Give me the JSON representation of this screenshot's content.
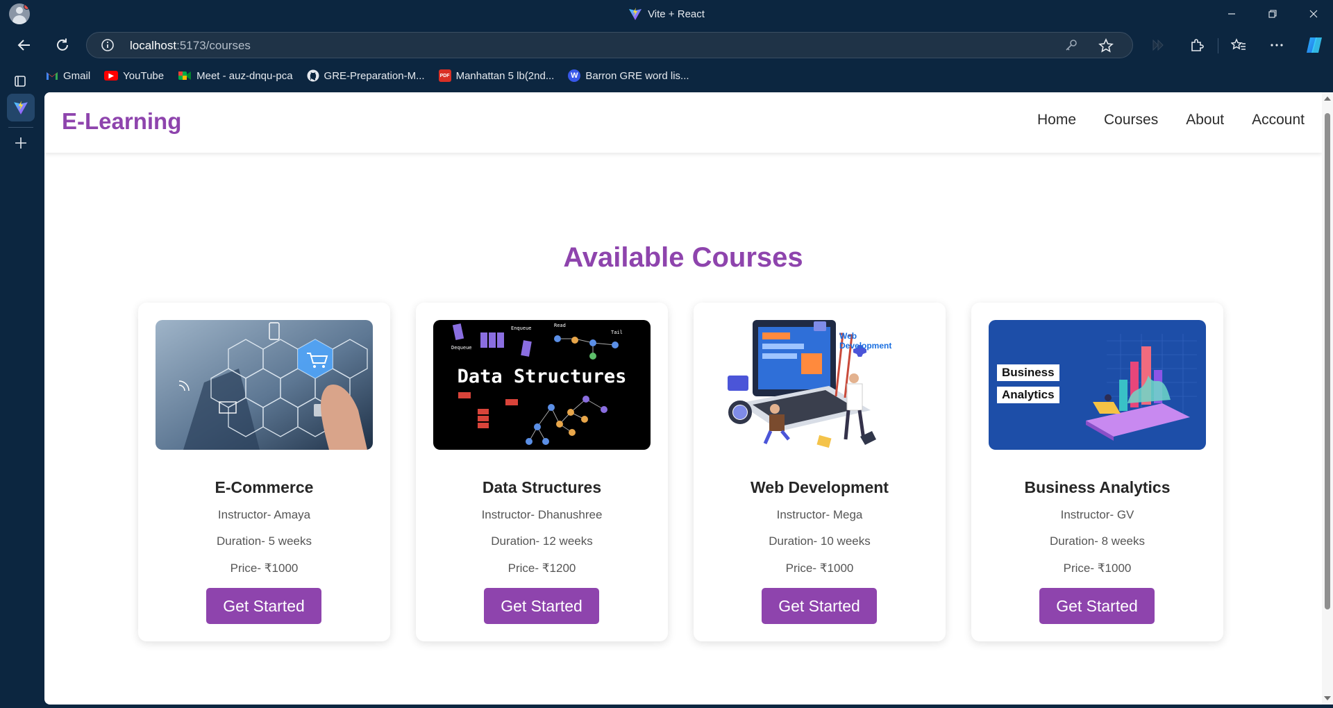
{
  "browser": {
    "window_title": "Vite + React",
    "url_host": "localhost",
    "url_rest": ":5173/courses",
    "bookmarks": [
      {
        "label": "Gmail",
        "icon": "gmail-icon"
      },
      {
        "label": "YouTube",
        "icon": "youtube-icon"
      },
      {
        "label": "Meet - auz-dnqu-pca",
        "icon": "meet-icon"
      },
      {
        "label": "GRE-Preparation-M...",
        "icon": "github-icon"
      },
      {
        "label": "Manhattan 5 lb(2nd...",
        "icon": "pdf-icon"
      },
      {
        "label": "Barron GRE word lis...",
        "icon": "wordpress-icon"
      }
    ]
  },
  "site": {
    "logo": "E-Learning",
    "nav": [
      "Home",
      "Courses",
      "About",
      "Account"
    ],
    "heading": "Available Courses",
    "courses": [
      {
        "title": "E-Commerce",
        "instructor": "Instructor- Amaya",
        "duration": "Duration- 5 weeks",
        "price": "Price- ₹1000",
        "button": "Get Started"
      },
      {
        "title": "Data Structures",
        "instructor": "Instructor- Dhanushree",
        "duration": "Duration- 12 weeks",
        "price": "Price- ₹1200",
        "button": "Get Started",
        "image_text": "Data Structures"
      },
      {
        "title": "Web Development",
        "instructor": "Instructor- Mega",
        "duration": "Duration- 10 weeks",
        "price": "Price- ₹1000",
        "button": "Get Started",
        "image_text_1": "Web",
        "image_text_2": "Development"
      },
      {
        "title": "Business Analytics",
        "instructor": "Instructor- GV",
        "duration": "Duration- 8 weeks",
        "price": "Price- ₹1000",
        "button": "Get Started",
        "image_text_1": "Business",
        "image_text_2": "Analytics"
      }
    ]
  },
  "colors": {
    "accent": "#8e44ad",
    "chrome": "#0c2640"
  }
}
